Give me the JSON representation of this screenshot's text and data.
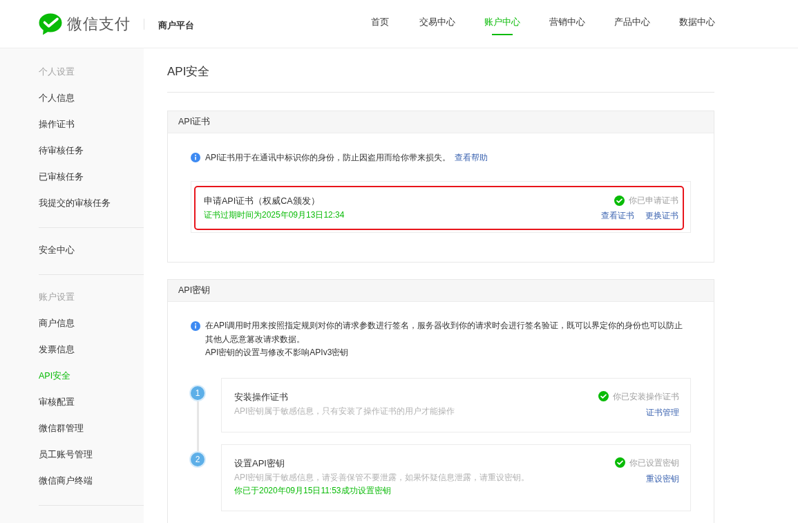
{
  "header": {
    "logo_text": "微信支付",
    "platform": "商户平台",
    "nav": [
      {
        "label": "首页",
        "selected": false
      },
      {
        "label": "交易中心",
        "selected": false
      },
      {
        "label": "账户中心",
        "selected": true
      },
      {
        "label": "营销中心",
        "selected": false
      },
      {
        "label": "产品中心",
        "selected": false
      },
      {
        "label": "数据中心",
        "selected": false
      }
    ]
  },
  "sidebar": {
    "groups": [
      {
        "title": "个人设置",
        "items": [
          {
            "label": "个人信息",
            "selected": false
          },
          {
            "label": "操作证书",
            "selected": false
          },
          {
            "label": "待审核任务",
            "selected": false
          },
          {
            "label": "已审核任务",
            "selected": false
          },
          {
            "label": "我提交的审核任务",
            "selected": false
          }
        ]
      },
      {
        "items": [
          {
            "label": "安全中心",
            "selected": false
          }
        ]
      },
      {
        "title": "账户设置",
        "items": [
          {
            "label": "商户信息",
            "selected": false
          },
          {
            "label": "发票信息",
            "selected": false
          },
          {
            "label": "API安全",
            "selected": true
          },
          {
            "label": "审核配置",
            "selected": false
          },
          {
            "label": "微信群管理",
            "selected": false
          },
          {
            "label": "员工账号管理",
            "selected": false
          },
          {
            "label": "微信商户终端",
            "selected": false
          }
        ]
      }
    ]
  },
  "page_title": "API安全",
  "certificate_section": {
    "title": "API证书",
    "info": "API证书用于在通讯中标识你的身份，防止因盗用而给你带来损失。",
    "help_link": "查看帮助",
    "certificate": {
      "title": "申请API证书（权威CA颁发）",
      "expiry": "证书过期时间为2025年09月13日12:34",
      "highlighted": true,
      "status": "你已申请证书",
      "links": [
        "查看证书",
        "更换证书"
      ]
    }
  },
  "key_section": {
    "title": "API密钥",
    "info": [
      "在API调用时用来按照指定规则对你的请求参数进行签名，服务器收到你的请求时会进行签名验证，既可以界定你的身份也可以防止其他人恶意篡改请求数据。",
      "API密钥的设置与修改不影响APIv3密钥"
    ],
    "steps": [
      {
        "number": "1",
        "title": "安装操作证书",
        "description": "API密钥属于敏感信息，只有安装了操作证书的用户才能操作",
        "status": "你已安装操作证书",
        "link": "证书管理"
      },
      {
        "number": "2",
        "title": "设置API密钥",
        "description": "API密钥属于敏感信息，请妥善保管不要泄露，如果怀疑信息泄露，请重设密钥。",
        "note": "你已于2020年09月15日11:53成功设置密钥",
        "status": "你已设置密钥",
        "link": "重设密钥"
      }
    ]
  }
}
